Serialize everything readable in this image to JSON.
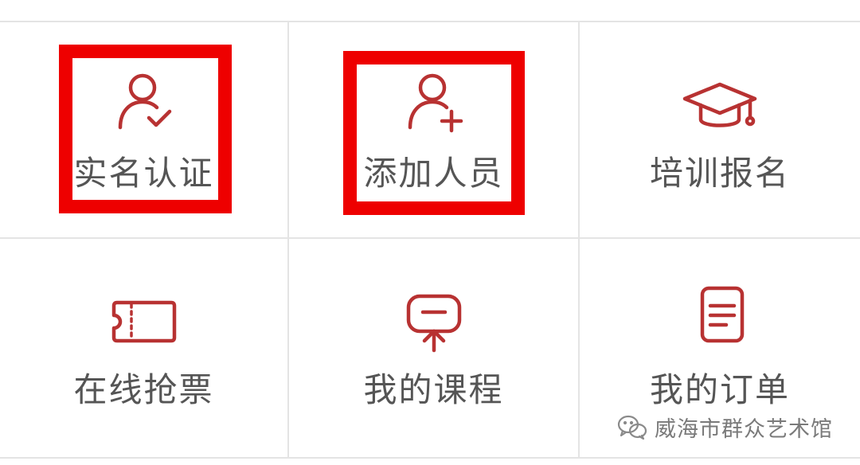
{
  "menu": {
    "items": [
      {
        "label": "实名认证",
        "icon": "user-check-icon",
        "highlighted": true
      },
      {
        "label": "添加人员",
        "icon": "user-add-icon",
        "highlighted": true
      },
      {
        "label": "培训报名",
        "icon": "graduation-cap-icon",
        "highlighted": false
      },
      {
        "label": "在线抢票",
        "icon": "ticket-icon",
        "highlighted": false
      },
      {
        "label": "我的课程",
        "icon": "presentation-icon",
        "highlighted": false
      },
      {
        "label": "我的订单",
        "icon": "order-document-icon",
        "highlighted": false
      }
    ]
  },
  "watermark": {
    "text": "威海市群众艺术馆",
    "icon": "wechat-icon"
  },
  "colors": {
    "icon": "#b83232",
    "label": "#555555",
    "highlight": "#ee0000",
    "divider": "#e4e4e4"
  }
}
